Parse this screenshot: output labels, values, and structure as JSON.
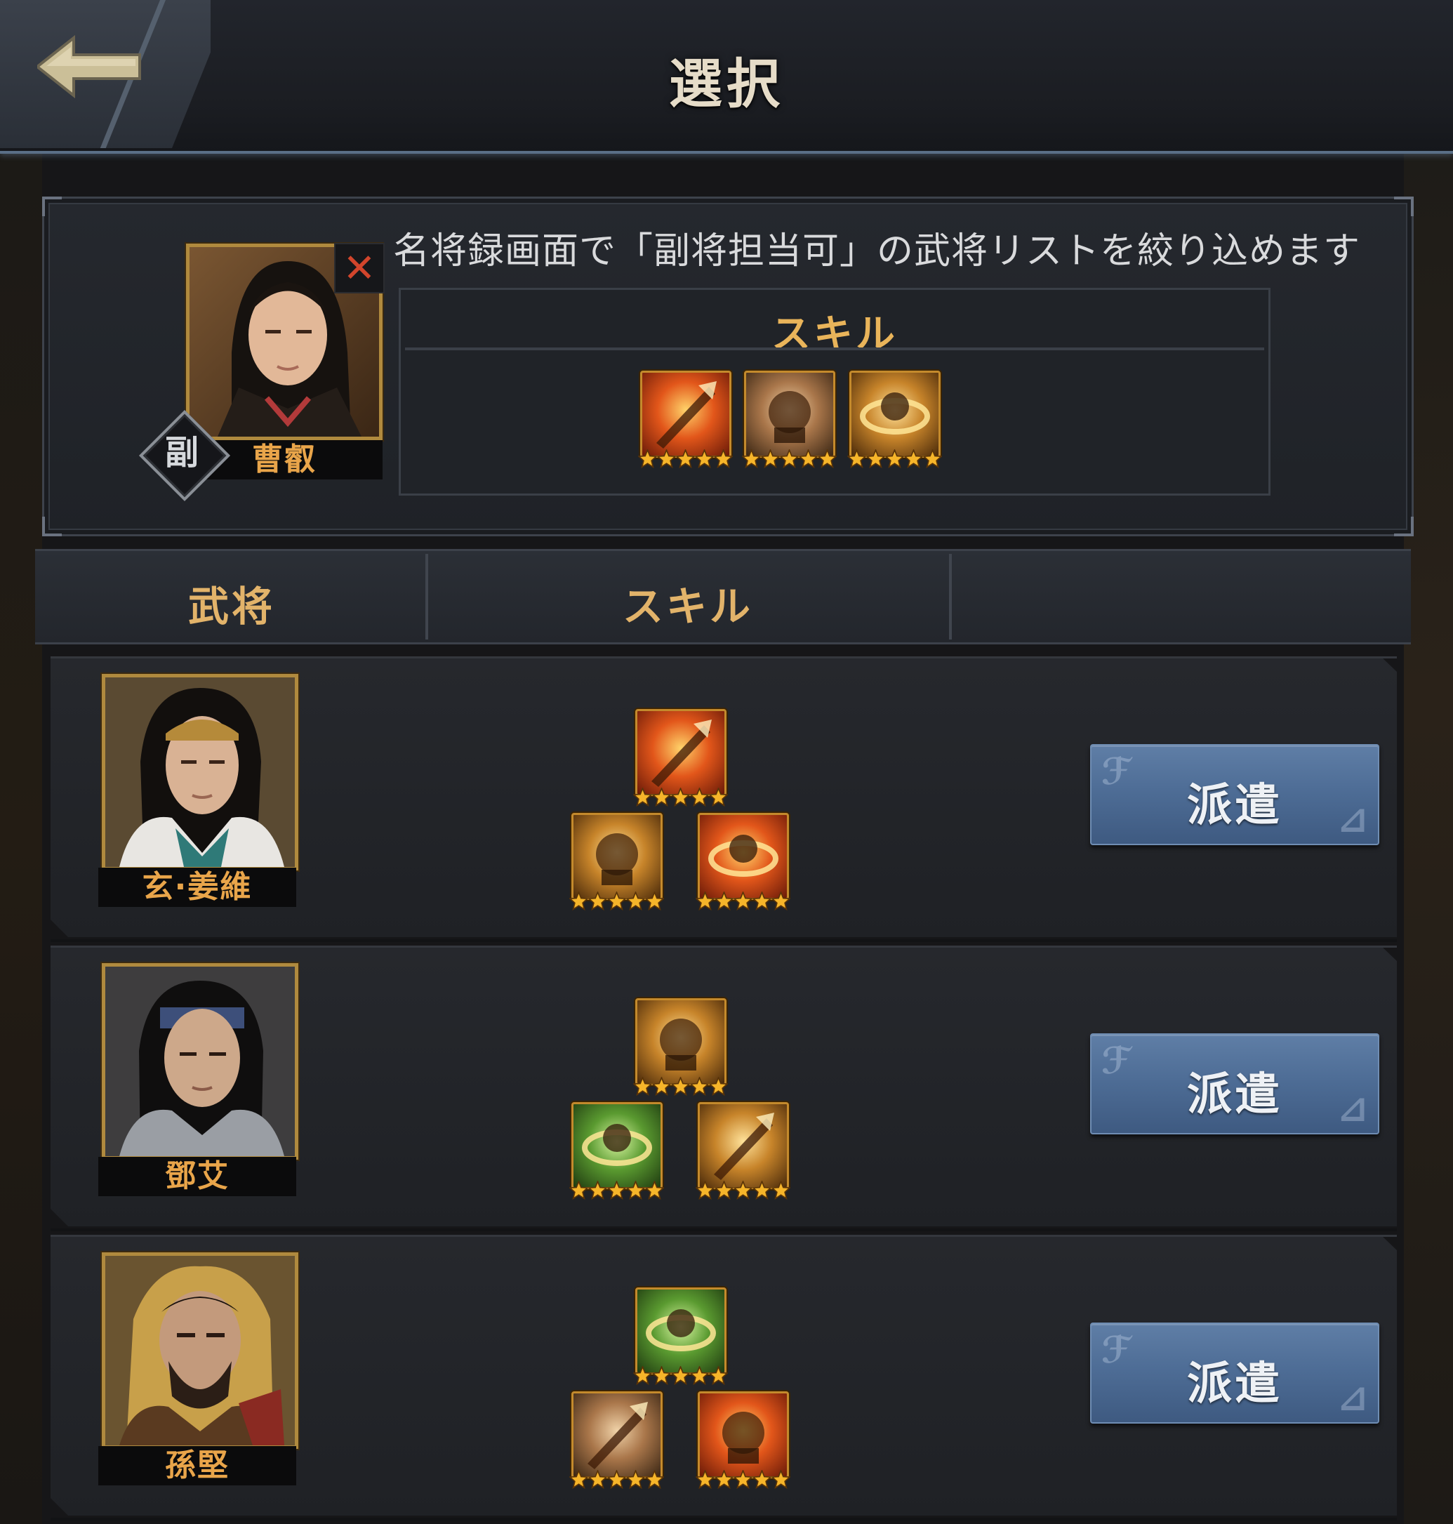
{
  "header": {
    "title": "選択",
    "back_icon": "back-arrow-icon"
  },
  "selected": {
    "name": "曹叡",
    "role_badge": "副",
    "hint": "名将録画面で「副将担当可」の武将リストを絞り込めます",
    "skills_title": "スキル",
    "skills": [
      {
        "icon": "flame-strike-skill-icon",
        "stars": 5,
        "tone": "fire"
      },
      {
        "icon": "cavalry-charge-skill-icon",
        "stars": 5,
        "tone": "bronze"
      },
      {
        "icon": "general-aura-skill-icon",
        "stars": 5,
        "tone": "gold"
      }
    ]
  },
  "table": {
    "col_general": "武将",
    "col_skill": "スキル"
  },
  "rows": [
    {
      "name": "玄·姜維",
      "button": "派遣",
      "skills": [
        {
          "icon": "spear-strike-skill-icon",
          "stars": 5,
          "tone": "fire"
        },
        {
          "icon": "lion-helmet-skill-icon",
          "stars": 5,
          "tone": "gold"
        },
        {
          "icon": "gauntlet-sword-skill-icon",
          "stars": 5,
          "tone": "fire"
        }
      ]
    },
    {
      "name": "鄧艾",
      "button": "派遣",
      "skills": [
        {
          "icon": "armor-shield-skill-icon",
          "stars": 5,
          "tone": "gold"
        },
        {
          "icon": "supply-cart-skill-icon",
          "stars": 5,
          "tone": "green"
        },
        {
          "icon": "beast-roar-skill-icon",
          "stars": 5,
          "tone": "gold"
        }
      ]
    },
    {
      "name": "孫堅",
      "button": "派遣",
      "skills": [
        {
          "icon": "supply-cart-skill-icon",
          "stars": 5,
          "tone": "green"
        },
        {
          "icon": "arrow-shield-skill-icon",
          "stars": 5,
          "tone": "bronze"
        },
        {
          "icon": "warrior-charge-skill-icon",
          "stars": 5,
          "tone": "fire"
        }
      ]
    }
  ]
}
